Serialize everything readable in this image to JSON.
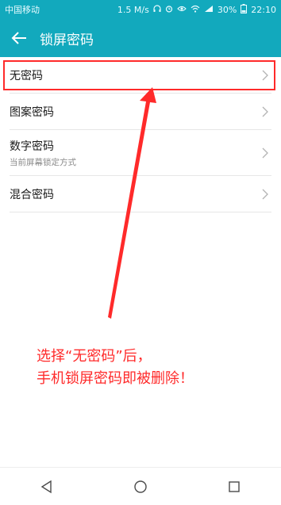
{
  "status_bar": {
    "carrier": "中国移动",
    "speed": "1.5 M/s",
    "battery": "30%",
    "time": "22:10"
  },
  "header": {
    "title": "锁屏密码",
    "back_icon": "arrow-left-icon"
  },
  "list": {
    "items": [
      {
        "label": "无密码",
        "sub": ""
      },
      {
        "label": "图案密码",
        "sub": ""
      },
      {
        "label": "数字密码",
        "sub": "当前屏幕锁定方式"
      },
      {
        "label": "混合密码",
        "sub": ""
      }
    ]
  },
  "annotation": {
    "line1": "选择“无密码”后，",
    "line2": "手机锁屏密码即被删除！",
    "color": "#ff2a2a"
  },
  "colors": {
    "accent": "#12a9bd",
    "highlight": "#ff2a2a"
  }
}
